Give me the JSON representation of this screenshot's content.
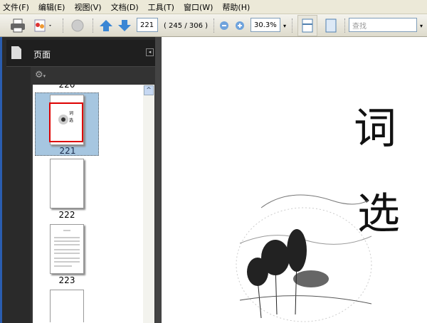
{
  "menubar": {
    "items": [
      "文件(F)",
      "编辑(E)",
      "视图(V)",
      "文档(D)",
      "工具(T)",
      "窗口(W)",
      "帮助(H)"
    ]
  },
  "toolbar": {
    "page_number": "221",
    "page_count": "( 245 / 306 )",
    "zoom": "30.3%",
    "search_placeholder": "查找"
  },
  "sidebar": {
    "title": "页面",
    "thumbnails": [
      {
        "label": "220"
      },
      {
        "label": "221",
        "selected": true
      },
      {
        "label": "222"
      },
      {
        "label": "223"
      }
    ]
  },
  "document": {
    "chars": [
      "词",
      "选"
    ]
  },
  "colors": {
    "selection": "#a6c6e0",
    "sidebar": "#2a2a2a"
  }
}
